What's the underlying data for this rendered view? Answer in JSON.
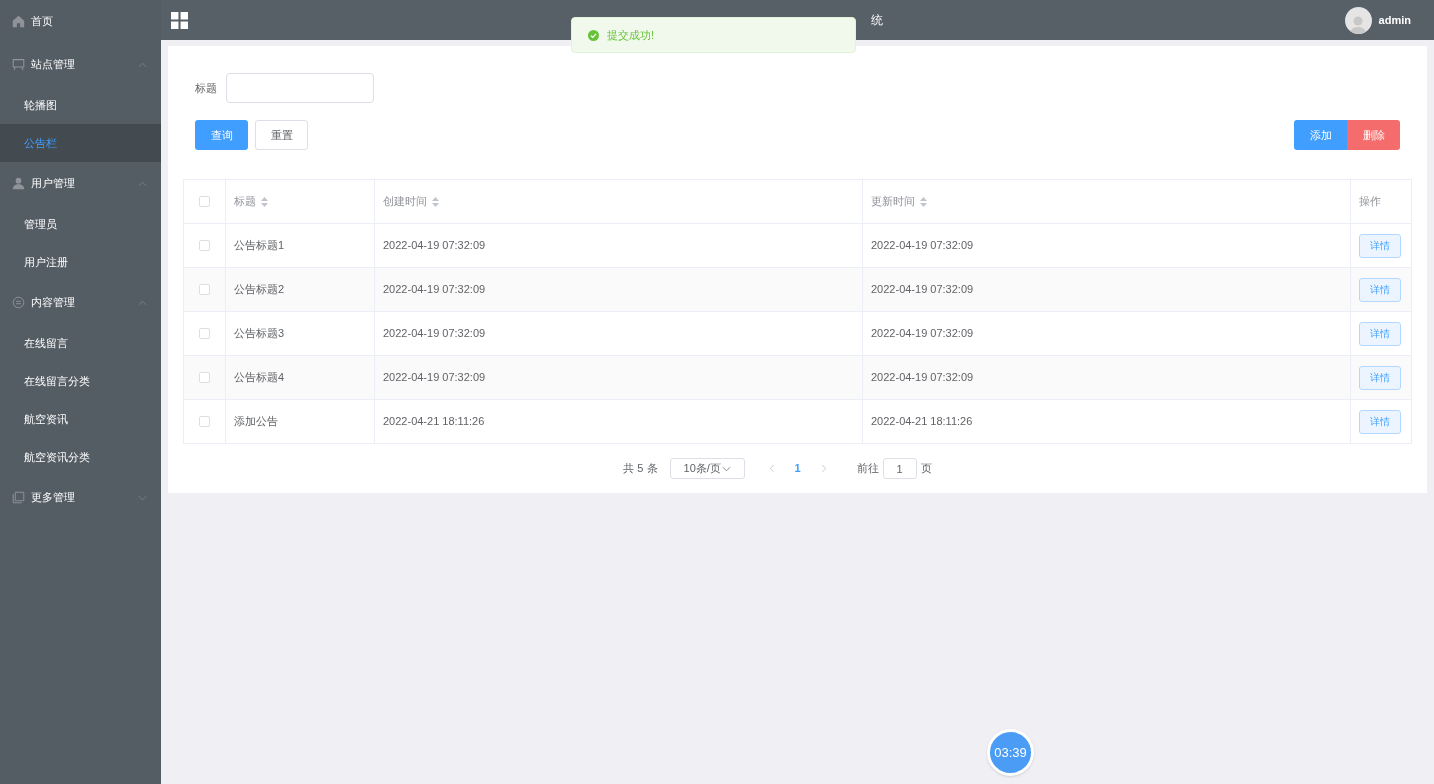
{
  "sidebar": {
    "items": [
      {
        "kind": "link",
        "label": "首页",
        "selected": false
      },
      {
        "kind": "group",
        "label": "站点管理",
        "expanded": true,
        "children": [
          {
            "label": "轮播图",
            "selected": false
          },
          {
            "label": "公告栏",
            "selected": true
          }
        ]
      },
      {
        "kind": "group",
        "label": "用户管理",
        "expanded": true,
        "children": [
          {
            "label": "管理员",
            "selected": false
          },
          {
            "label": "用户注册",
            "selected": false
          }
        ]
      },
      {
        "kind": "group",
        "label": "内容管理",
        "expanded": true,
        "children": [
          {
            "label": "在线留言",
            "selected": false
          },
          {
            "label": "在线留言分类",
            "selected": false
          },
          {
            "label": "航空资讯",
            "selected": false
          },
          {
            "label": "航空资讯分类",
            "selected": false
          }
        ]
      },
      {
        "kind": "group",
        "label": "更多管理",
        "expanded": false
      }
    ]
  },
  "header": {
    "title": "统",
    "user": "admin"
  },
  "toast": {
    "message": "提交成功!"
  },
  "search": {
    "label": "标题",
    "query_button": "查询",
    "reset_button": "重置"
  },
  "actions": {
    "add": "添加",
    "delete": "删除"
  },
  "table": {
    "all_checked": false,
    "columns": [
      "标题",
      "创建时间",
      "更新时间",
      "操作"
    ],
    "rows": [
      {
        "checked": false,
        "title": "公告标题1",
        "created": "2022-04-19 07:32:09",
        "updated": "2022-04-19 07:32:09",
        "action": "详情"
      },
      {
        "checked": false,
        "title": "公告标题2",
        "created": "2022-04-19 07:32:09",
        "updated": "2022-04-19 07:32:09",
        "action": "详情"
      },
      {
        "checked": false,
        "title": "公告标题3",
        "created": "2022-04-19 07:32:09",
        "updated": "2022-04-19 07:32:09",
        "action": "详情"
      },
      {
        "checked": false,
        "title": "公告标题4",
        "created": "2022-04-19 07:32:09",
        "updated": "2022-04-19 07:32:09",
        "action": "详情"
      },
      {
        "checked": false,
        "title": "添加公告",
        "created": "2022-04-21 18:11:26",
        "updated": "2022-04-21 18:11:26",
        "action": "详情"
      }
    ]
  },
  "pagination": {
    "total": "共 5 条",
    "page_size": "10条/页",
    "current": "1",
    "goto_label": "前往",
    "goto_value": "1",
    "page_suffix": "页"
  },
  "timer": "03:39"
}
